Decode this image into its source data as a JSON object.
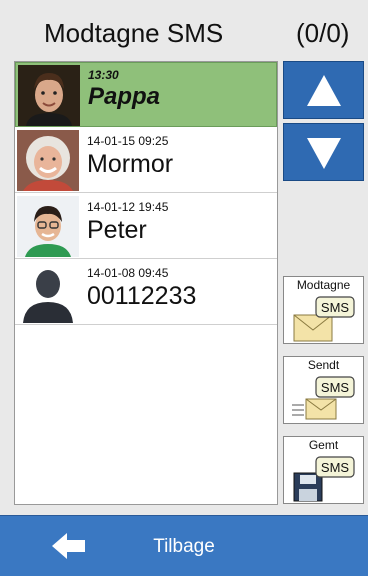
{
  "header": {
    "title": "Modtagne SMS",
    "count": "(0/0)"
  },
  "messages": [
    {
      "time": "13:30",
      "name": "Pappa",
      "selected": true
    },
    {
      "time": "14-01-15 09:25",
      "name": "Mormor",
      "selected": false
    },
    {
      "time": "14-01-12 19:45",
      "name": "Peter",
      "selected": false
    },
    {
      "time": "14-01-08 09:45",
      "name": "00112233",
      "selected": false
    }
  ],
  "side_buttons": {
    "received": {
      "label": "Modtagne",
      "badge": "SMS"
    },
    "sent": {
      "label": "Sendt",
      "badge": "SMS"
    },
    "saved": {
      "label": "Gemt",
      "badge": "SMS"
    }
  },
  "bottom_bar": {
    "back_label": "Tilbage"
  },
  "colors": {
    "selected_row": "#8fc07a",
    "accent_blue": "#2f6ab2",
    "bottom_bar": "#3a78c2"
  },
  "icons": [
    "arrow-up-icon",
    "arrow-down-icon",
    "envelope-icon",
    "sent-letter-icon",
    "floppy-disk-icon",
    "back-arrow-icon"
  ]
}
